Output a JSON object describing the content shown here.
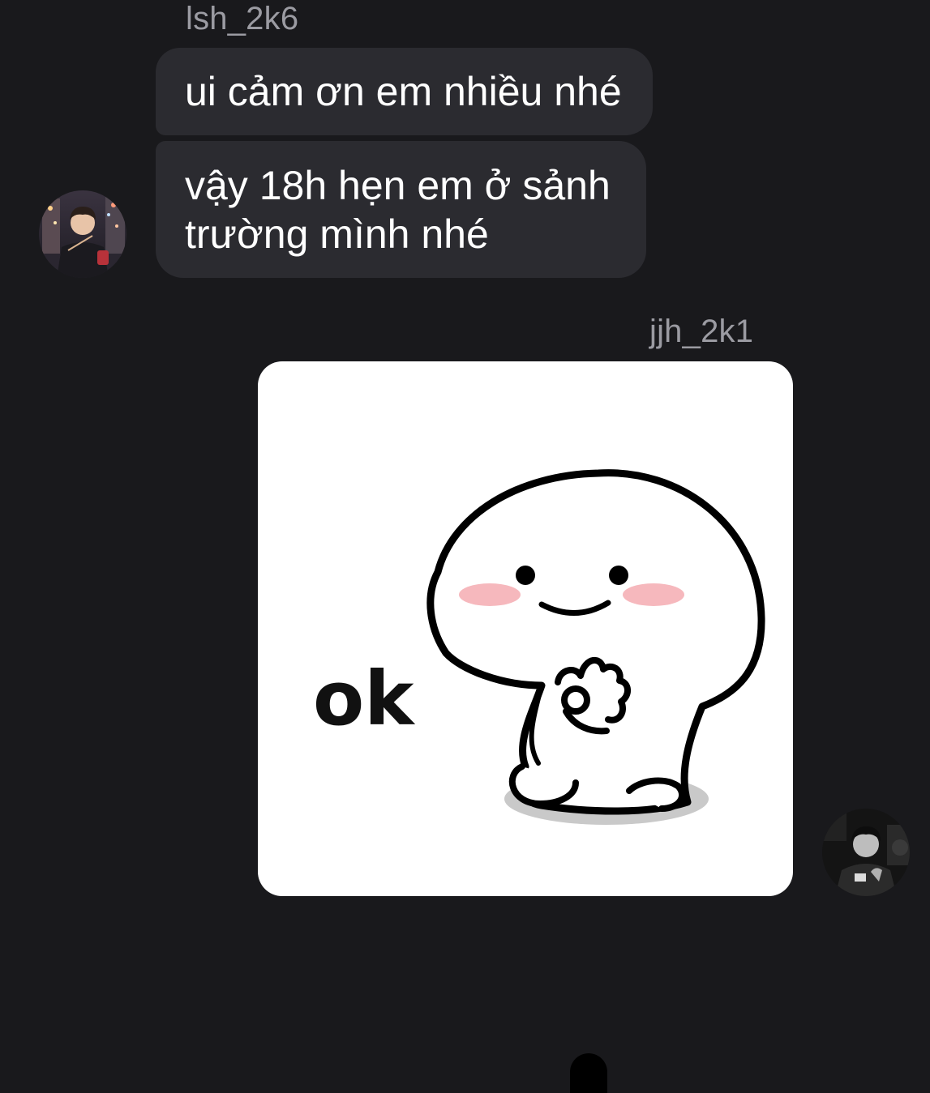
{
  "conversation": {
    "incoming": {
      "sender_name": "lsh_2k6",
      "messages": [
        "ui cảm ơn em nhiều nhé",
        "vậy 18h hẹn em ở sảnh trường mình nhé"
      ],
      "avatar_icon": "person-photo-avatar"
    },
    "outgoing": {
      "sender_name": "jjh_2k1",
      "sticker": {
        "text": "ok",
        "icon": "smiling-blob-ok-hand-sticker"
      },
      "avatar_icon": "person-photo-avatar"
    }
  },
  "colors": {
    "background": "#19191c",
    "incoming_bubble": "#2b2b30",
    "name_text": "#9b9ba2",
    "message_text": "#ffffff",
    "sticker_bg": "#ffffff",
    "blush": "#f6b8bd"
  }
}
